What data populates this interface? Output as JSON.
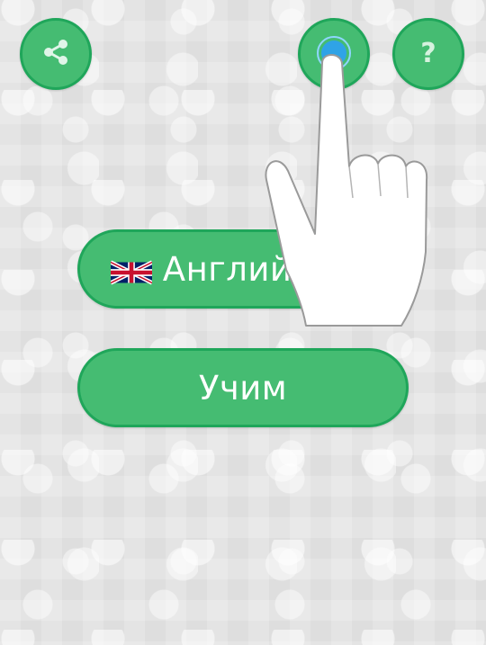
{
  "header": {
    "share_icon": "share-icon",
    "settings_icon": "gear-icon",
    "help_label": "?"
  },
  "menu": {
    "language_flag": "uk-flag-icon",
    "language_label": "Английский",
    "learn_label": "Учим"
  },
  "colors": {
    "button_fill": "#45bc72",
    "button_border": "#1fa65a",
    "tap_indicator": "#2fa3e6"
  }
}
